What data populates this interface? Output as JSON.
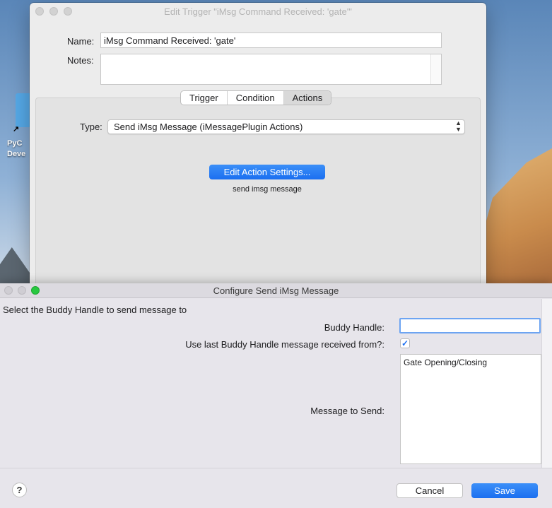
{
  "desktop": {
    "folder_label": "PyC Deve",
    "alias_glyph": "↗"
  },
  "back_window": {
    "title": "Edit Trigger \"iMsg Command Received: 'gate'\"",
    "name_label": "Name:",
    "name_value": "iMsg Command Received: 'gate'",
    "notes_label": "Notes:",
    "notes_value": "",
    "tabs": [
      {
        "label": "Trigger",
        "active": false
      },
      {
        "label": "Condition",
        "active": false
      },
      {
        "label": "Actions",
        "active": true
      }
    ],
    "type_label": "Type:",
    "type_value": "Send iMsg Message (iMessagePlugin Actions)",
    "edit_button": "Edit Action Settings...",
    "action_description": "send imsg message"
  },
  "dialog": {
    "title": "Configure Send iMsg Message",
    "section_title": "Select the Buddy Handle to send message to",
    "buddy_label": "Buddy Handle:",
    "buddy_value": "",
    "use_last_label": "Use last Buddy Handle message received from?:",
    "use_last_checked": true,
    "message_label": "Message to Send:",
    "message_value": "Gate Opening/Closing",
    "help_label": "?",
    "cancel_label": "Cancel",
    "save_label": "Save"
  },
  "colors": {
    "accent": "#1b6ff0",
    "close_green": "#28c840"
  }
}
